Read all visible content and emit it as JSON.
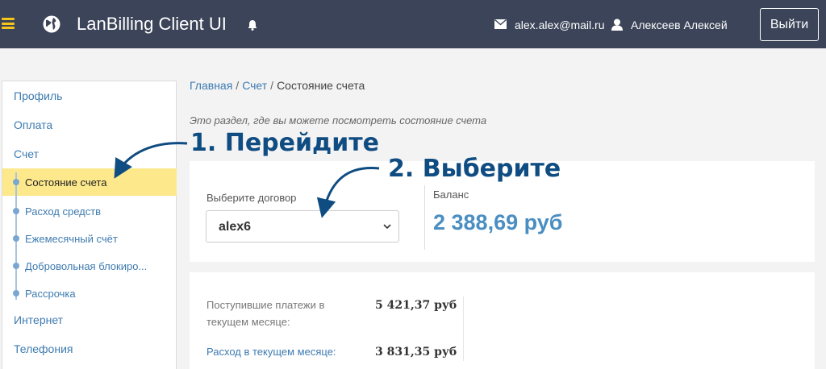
{
  "header": {
    "app_title": "LanBilling Client UI",
    "email": "alex.alex@mail.ru",
    "username": "Алексеев Алексей",
    "logout_label": "Выйти",
    "colors": {
      "bar": "#3b4458",
      "accent": "#f5c518"
    }
  },
  "sidebar": {
    "items": [
      {
        "label": "Профиль"
      },
      {
        "label": "Оплата"
      },
      {
        "label": "Счет"
      },
      {
        "label": "Интернет"
      },
      {
        "label": "Телефония"
      }
    ],
    "sub_items": [
      {
        "label": "Состояние счета",
        "active": true
      },
      {
        "label": "Расход средств"
      },
      {
        "label": "Ежемесячный счёт"
      },
      {
        "label": "Добровольная блокиро..."
      },
      {
        "label": "Рассрочка"
      }
    ]
  },
  "breadcrumb": {
    "home": "Главная",
    "account": "Счет",
    "current": "Состояние счета",
    "separator": "/"
  },
  "main": {
    "intro": "Это раздел, где вы можете посмотреть состояние счета",
    "contract_label": "Выберите договор",
    "contract_value": "alex6",
    "balance_label": "Баланс",
    "balance_value": "2 388,69  руб",
    "rows": [
      {
        "label": "Поступившие платежи в текущем месяце:",
        "value": "5 421,37  руб"
      },
      {
        "label": "Расход в текущем месяце:",
        "value": "3 831,35  руб"
      }
    ]
  },
  "annotations": {
    "step1": "1. Перейдите",
    "step2": "2. Выберите",
    "color": "#0f4c81"
  }
}
